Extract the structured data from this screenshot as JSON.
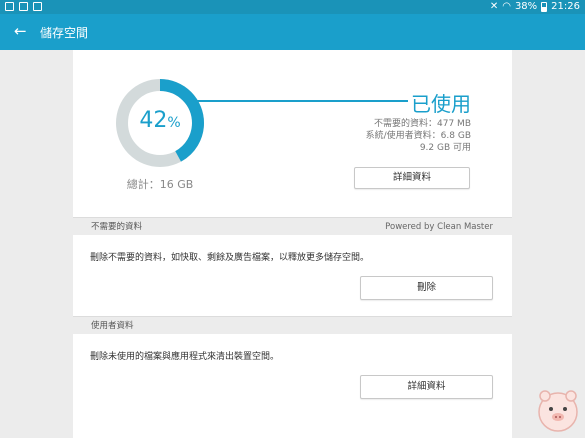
{
  "status_bar": {
    "battery": "38%",
    "time": "21:26"
  },
  "app_bar": {
    "back_icon": "arrow-left-icon",
    "title": "儲存空間"
  },
  "storage": {
    "percent_used": 42,
    "percent_label": "42",
    "percent_unit": "%",
    "used_label": "已使用",
    "unnecessary_line": "不需要的資料：477 MB",
    "system_line": "系統/使用者資料：6.8 GB",
    "available_line": "9.2 GB 可用",
    "total_label": "總計：16 GB",
    "details_button": "詳細資料",
    "colors": {
      "used": "#1a9fcb",
      "free": "#d3dadb"
    }
  },
  "unnecessary_section": {
    "header": "不需要的資料",
    "powered_by": "Powered by Clean Master",
    "description": "刪除不需要的資料，如快取、剩餘及廣告檔案，以釋放更多儲存空間。",
    "delete_button": "刪除"
  },
  "user_section": {
    "header": "使用者資料",
    "description": "刪除未使用的檔案與應用程式來清出裝置空間。",
    "details_button": "詳細資料"
  }
}
